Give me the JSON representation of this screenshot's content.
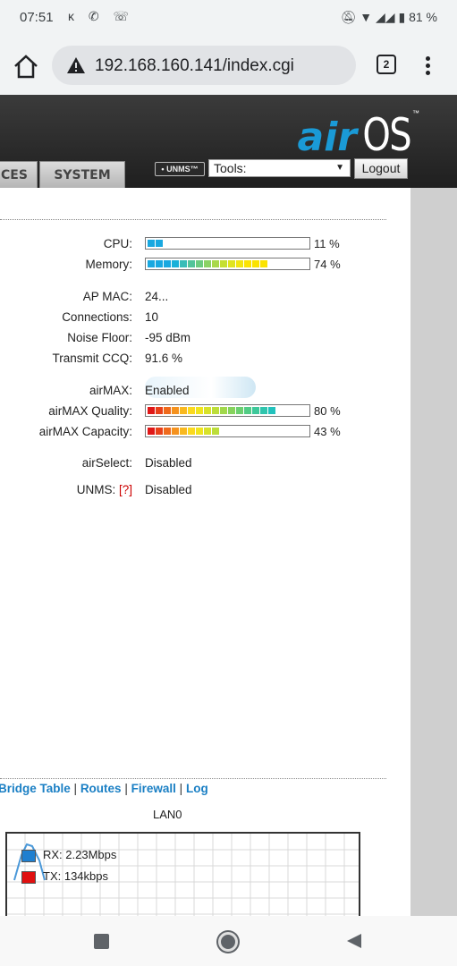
{
  "status_bar": {
    "time": "07:51",
    "battery": "81 %"
  },
  "browser": {
    "url": "192.168.160.141/index.cgi",
    "tab_count": "2"
  },
  "header": {
    "logo_air": "air",
    "logo_os": "OS",
    "logo_tm": "™",
    "tab_services": "CES",
    "tab_system": "SYSTEM",
    "unms_badge": "• UNMS™",
    "tools_label": "Tools:",
    "logout_label": "Logout"
  },
  "status": {
    "cpu": {
      "label": "CPU:",
      "pct_text": "11 %",
      "level": 0.11
    },
    "memory": {
      "label": "Memory:",
      "pct_text": "74 %",
      "level": 0.74
    },
    "ap_mac": {
      "label": "AP MAC:",
      "value": "24..."
    },
    "connections": {
      "label": "Connections:",
      "value": "10"
    },
    "noise_floor": {
      "label": "Noise Floor:",
      "value": "-95 dBm"
    },
    "transmit_ccq": {
      "label": "Transmit CCQ:",
      "value": "91.6 %"
    },
    "airmax": {
      "label": "airMAX:",
      "value": "Enabled"
    },
    "airmax_quality": {
      "label": "airMAX Quality:",
      "pct_text": "80 %",
      "level": 0.8
    },
    "airmax_capacity": {
      "label": "airMAX Capacity:",
      "pct_text": "43 %",
      "level": 0.43
    },
    "airselect": {
      "label": "airSelect:",
      "value": "Disabled"
    },
    "unms": {
      "label": "UNMS:",
      "help": "[?]",
      "value": "Disabled"
    }
  },
  "links": {
    "bridge_table": "Bridge Table",
    "routes": "Routes",
    "firewall": "Firewall",
    "log": "Log",
    "separator": "|"
  },
  "throughput": {
    "title": "LAN0",
    "rx": {
      "label": "RX: 2.23Mbps",
      "color": "#1e7fd0"
    },
    "tx": {
      "label": "TX: 134kbps",
      "color": "#e01010"
    }
  },
  "colors": {
    "accent": "#1a7fc4",
    "cpu_bar": "#19a8e0"
  }
}
